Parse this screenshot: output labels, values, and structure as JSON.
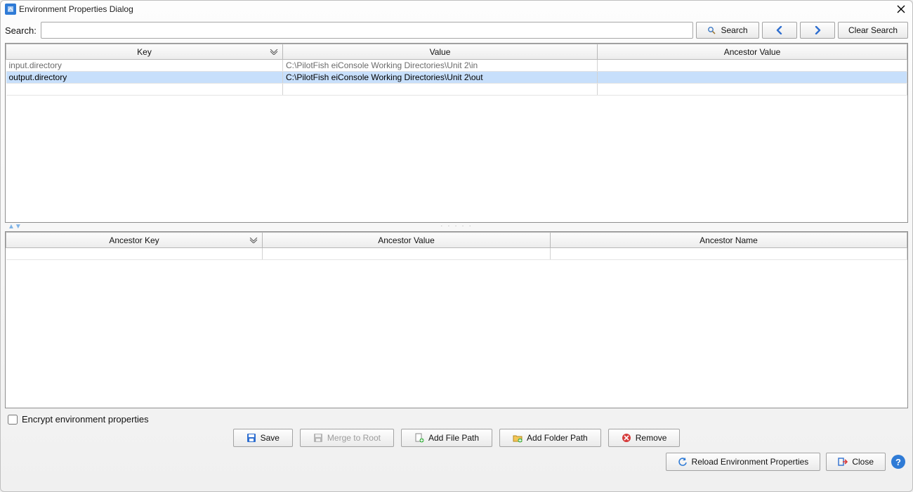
{
  "title": "Environment Properties Dialog",
  "search": {
    "label": "Search:",
    "value": "",
    "search_button": "Search",
    "clear_button": "Clear Search"
  },
  "upper_table": {
    "columns": [
      "Key",
      "Value",
      "Ancestor Value"
    ],
    "rows": [
      {
        "key": "input.directory",
        "value": "C:\\PilotFish eiConsole Working Directories\\Unit 2\\in",
        "ancestor": "",
        "selected": false
      },
      {
        "key": "output.directory",
        "value": "C:\\PilotFish eiConsole Working Directories\\Unit 2\\out",
        "ancestor": "",
        "selected": true
      },
      {
        "key": "",
        "value": "",
        "ancestor": "",
        "selected": false
      }
    ]
  },
  "lower_table": {
    "columns": [
      "Ancestor Key",
      "Ancestor Value",
      "Ancestor Name"
    ],
    "rows": [
      {
        "key": "",
        "value": "",
        "name": ""
      }
    ]
  },
  "encrypt": {
    "label": "Encrypt environment properties",
    "checked": false
  },
  "buttons": {
    "save": "Save",
    "merge": "Merge to Root",
    "add_file": "Add File Path",
    "add_folder": "Add Folder Path",
    "remove": "Remove",
    "reload": "Reload Environment Properties",
    "close": "Close"
  }
}
